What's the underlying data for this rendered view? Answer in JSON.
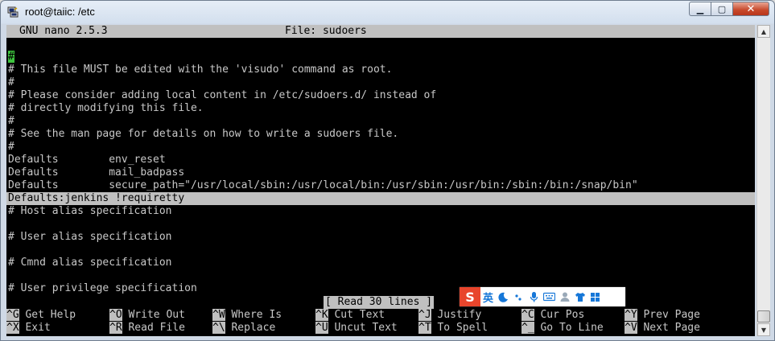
{
  "window": {
    "title": "root@taiic: /etc",
    "buttons": {
      "minimize": "▁",
      "maximize": "▢",
      "close": "✕"
    }
  },
  "nano": {
    "version": "GNU nano 2.5.3",
    "file_label": "File: sudoers"
  },
  "lines": [
    "#",
    "# This file MUST be edited with the 'visudo' command as root.",
    "#",
    "# Please consider adding local content in /etc/sudoers.d/ instead of",
    "# directly modifying this file.",
    "#",
    "# See the man page for details on how to write a sudoers file.",
    "#",
    "Defaults        env_reset",
    "Defaults        mail_badpass",
    "Defaults        secure_path=\"/usr/local/sbin:/usr/local/bin:/usr/sbin:/usr/bin:/sbin:/bin:/snap/bin\"",
    "Defaults:jenkins !requiretty",
    "# Host alias specification",
    "",
    "# User alias specification",
    "",
    "# Cmnd alias specification",
    "",
    "# User privilege specification"
  ],
  "status_message": "[ Read 30 lines ]",
  "shortcuts": [
    [
      {
        "key": "^G",
        "label": "Get Help"
      },
      {
        "key": "^O",
        "label": "Write Out"
      },
      {
        "key": "^W",
        "label": "Where Is"
      },
      {
        "key": "^K",
        "label": "Cut Text"
      },
      {
        "key": "^J",
        "label": "Justify"
      },
      {
        "key": "^C",
        "label": "Cur Pos"
      },
      {
        "key": "^Y",
        "label": "Prev Page"
      }
    ],
    [
      {
        "key": "^X",
        "label": "Exit"
      },
      {
        "key": "^R",
        "label": "Read File"
      },
      {
        "key": "^\\",
        "label": "Replace"
      },
      {
        "key": "^U",
        "label": "Uncut Text"
      },
      {
        "key": "^T",
        "label": "To Spell"
      },
      {
        "key": "^_",
        "label": "Go To Line"
      },
      {
        "key": "^V",
        "label": "Next Page"
      }
    ]
  ],
  "ime": {
    "logo": "S",
    "lang": "英",
    "icons": [
      "moon-icon",
      "punctuation-icon",
      "microphone-icon",
      "keyboard-icon",
      "user-icon",
      "shirt-icon",
      "grid-icon"
    ],
    "accent": "#1677d8",
    "brand": "#e8452c"
  },
  "colors": {
    "terminal_bg": "#000000",
    "terminal_fg": "#c8c8c8",
    "highlight_bg": "#c0c0c0",
    "cursor": "#3ec43e"
  }
}
